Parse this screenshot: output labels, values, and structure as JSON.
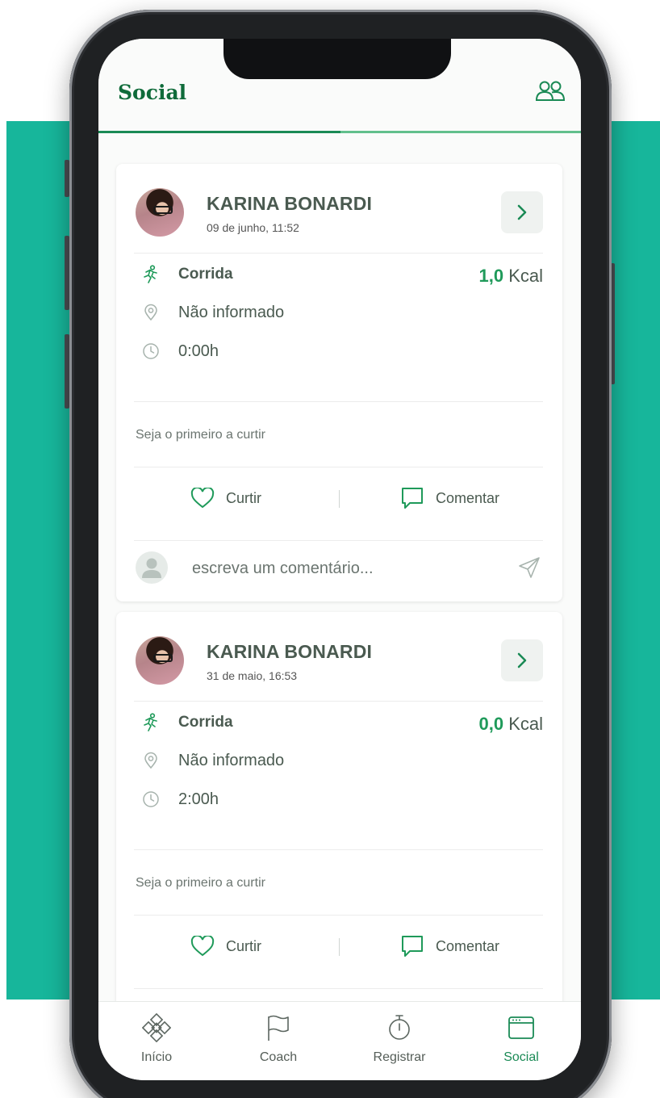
{
  "header": {
    "title": "Social"
  },
  "posts": [
    {
      "user": "KARINA BONARDI",
      "date": "09 de junho, 11:52",
      "activity": "Corrida",
      "kcal_value": "1,0",
      "kcal_unit": "Kcal",
      "location": "Não informado",
      "duration": "0:00h",
      "likes_text": "Seja o primeiro a curtir",
      "like_label": "Curtir",
      "comment_label": "Comentar",
      "comment_placeholder": "escreva um comentário..."
    },
    {
      "user": "KARINA BONARDI",
      "date": "31 de maio, 16:53",
      "activity": "Corrida",
      "kcal_value": "0,0",
      "kcal_unit": "Kcal",
      "location": "Não informado",
      "duration": "2:00h",
      "likes_text": "Seja o primeiro a curtir",
      "like_label": "Curtir",
      "comment_label": "Comentar"
    }
  ],
  "bottom_nav": {
    "items": [
      {
        "label": "Início",
        "icon": "home-logo-icon",
        "active": false
      },
      {
        "label": "Coach",
        "icon": "flag-icon",
        "active": false
      },
      {
        "label": "Registrar",
        "icon": "stopwatch-icon",
        "active": false
      },
      {
        "label": "Social",
        "icon": "social-feed-icon",
        "active": true
      }
    ]
  },
  "colors": {
    "accent": "#1a8a55",
    "background_band": "#17b69b",
    "text": "#4a5a50"
  }
}
